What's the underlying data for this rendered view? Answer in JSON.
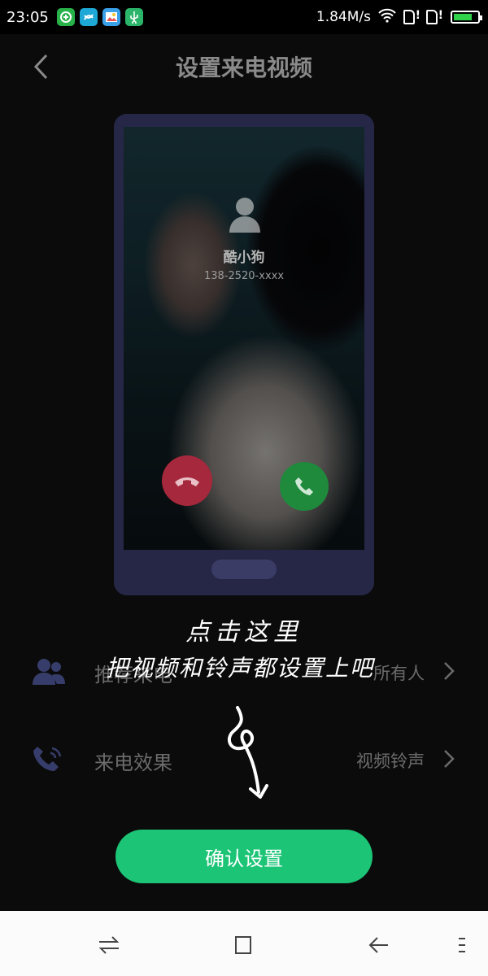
{
  "status_bar": {
    "time": "23:05",
    "net_speed": "1.84M/s",
    "battery_fraction": 0.8,
    "battery_color": "#2fd24a",
    "app_icons": [
      {
        "name": "app-icon-green",
        "color": "#27b24a"
      },
      {
        "name": "app-icon-teal",
        "color": "#1da8d6"
      },
      {
        "name": "app-icon-gallery",
        "color": "#3ba0ea"
      },
      {
        "name": "usb-icon",
        "color": "#2bb56a"
      }
    ]
  },
  "header": {
    "title": "设置来电视频",
    "back_icon": "chevron-left-icon"
  },
  "preview": {
    "caller_name": "酷小狗",
    "caller_number": "138-2520-xxxx",
    "decline_color": "#a6283c",
    "accept_color": "#1f8a3c"
  },
  "settings": {
    "rows": [
      {
        "label": "推荐来电",
        "value": "所有人",
        "icon": "contacts-icon"
      },
      {
        "label": "来电效果",
        "value": "视频铃声",
        "icon": "phone-ring-icon"
      }
    ]
  },
  "overlay": {
    "line1": "点击这里",
    "line2": "把视频和铃声都设置上吧"
  },
  "confirm": {
    "label": "确认设置",
    "color": "#1cc476"
  }
}
